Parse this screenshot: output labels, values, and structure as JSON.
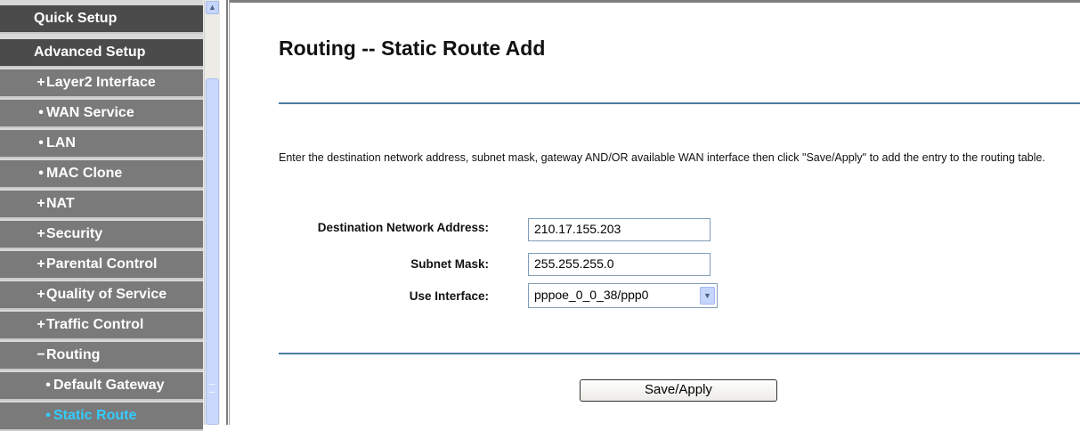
{
  "sidebar": {
    "items": [
      {
        "label": "Quick Setup",
        "bullet": "",
        "kind": "top"
      },
      {
        "label": "Advanced Setup",
        "bullet": "",
        "kind": "top"
      },
      {
        "label": "Layer2 Interface",
        "bullet": "+",
        "kind": "sub"
      },
      {
        "label": "WAN Service",
        "bullet": "•",
        "kind": "sub"
      },
      {
        "label": "LAN",
        "bullet": "•",
        "kind": "sub"
      },
      {
        "label": "MAC Clone",
        "bullet": "•",
        "kind": "sub"
      },
      {
        "label": "NAT",
        "bullet": "+",
        "kind": "sub"
      },
      {
        "label": "Security",
        "bullet": "+",
        "kind": "sub"
      },
      {
        "label": "Parental Control",
        "bullet": "+",
        "kind": "sub"
      },
      {
        "label": "Quality of Service",
        "bullet": "+",
        "kind": "sub"
      },
      {
        "label": "Traffic Control",
        "bullet": "+",
        "kind": "sub"
      },
      {
        "label": "Routing",
        "bullet": "−",
        "kind": "sub"
      },
      {
        "label": "Default Gateway",
        "bullet": "•",
        "kind": "sub2"
      },
      {
        "label": "Static Route",
        "bullet": "•",
        "kind": "active"
      }
    ],
    "active_color": "#33ccff"
  },
  "main": {
    "title": "Routing -- Static Route Add",
    "instructions": "Enter the destination network address, subnet mask, gateway AND/OR available WAN interface then click \"Save/Apply\" to add the entry to the routing table.",
    "form": {
      "destination_label": "Destination Network Address:",
      "destination_value": "210.17.155.203",
      "subnet_label": "Subnet Mask:",
      "subnet_value": "255.255.255.0",
      "interface_label": "Use Interface:",
      "interface_value": "pppoe_0_0_38/ppp0"
    },
    "save_label": "Save/Apply"
  },
  "icons": {
    "scroll_up": "chevron-up-icon",
    "select_arrow": "chevron-down-icon"
  }
}
